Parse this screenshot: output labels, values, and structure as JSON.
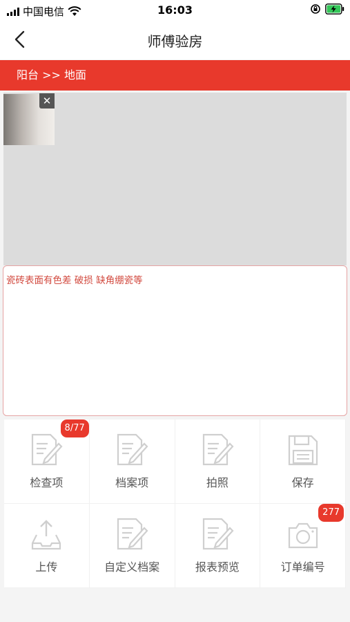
{
  "status_bar": {
    "carrier": "中国电信",
    "time": "16:03"
  },
  "nav": {
    "title": "师傅验房"
  },
  "breadcrumb": "阳台 >> 地面",
  "photo": {
    "close_symbol": "✕"
  },
  "note_text": "瓷砖表面有色差 破损 缺角绷瓷等",
  "actions": [
    {
      "label": "检查项",
      "icon": "document-edit-icon",
      "badge": "8/77"
    },
    {
      "label": "档案项",
      "icon": "document-edit-icon",
      "badge": ""
    },
    {
      "label": "拍照",
      "icon": "document-edit-icon",
      "badge": ""
    },
    {
      "label": "保存",
      "icon": "floppy-disk-icon",
      "badge": ""
    },
    {
      "label": "上传",
      "icon": "upload-tray-icon",
      "badge": ""
    },
    {
      "label": "自定义档案",
      "icon": "document-edit-icon",
      "badge": ""
    },
    {
      "label": "报表预览",
      "icon": "document-edit-icon",
      "badge": ""
    },
    {
      "label": "订单编号",
      "icon": "camera-icon",
      "badge": "277"
    }
  ],
  "colors": {
    "accent": "#e8392c",
    "note_text": "#d24a3f",
    "icon_gray": "#cfcfcf"
  }
}
